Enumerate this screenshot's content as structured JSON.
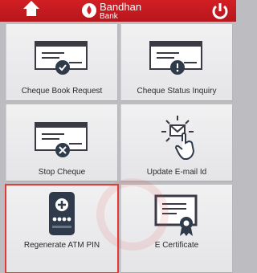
{
  "header": {
    "brand_name": "Bandhan",
    "brand_sub": "Bank",
    "home_icon": "home-icon",
    "power_icon": "power-icon",
    "accent": "#c4181d"
  },
  "tiles": [
    {
      "label": "Cheque Book Request",
      "icon": "cheque-add-icon",
      "highlighted": false
    },
    {
      "label": "Cheque Status Inquiry",
      "icon": "cheque-alert-icon",
      "highlighted": false
    },
    {
      "label": "Stop Cheque",
      "icon": "cheque-cancel-icon",
      "highlighted": false
    },
    {
      "label": "Update E-mail Id",
      "icon": "email-touch-icon",
      "highlighted": false
    },
    {
      "label": "Regenerate ATM PIN",
      "icon": "atm-pin-icon",
      "highlighted": true
    },
    {
      "label": "E Certificate",
      "icon": "certificate-icon",
      "highlighted": false
    }
  ],
  "highlight_color": "#e53935"
}
